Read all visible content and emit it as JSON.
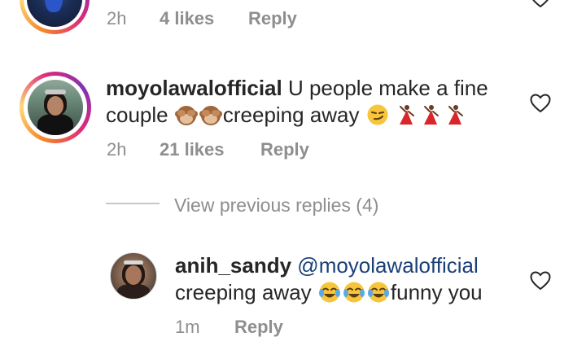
{
  "top_comment": {
    "time": "2h",
    "likes": "4 likes",
    "reply": "Reply"
  },
  "comment": {
    "username": "moyolawalofficial",
    "text_line1": "U people make a fine",
    "text_line2a": "couple",
    "text_line2b": "creeping away",
    "time": "2h",
    "likes": "21 likes",
    "reply": "Reply"
  },
  "view_previous": "View previous replies (4)",
  "reply_comment": {
    "username": "anih_sandy",
    "mention": "@moyolawalofficial",
    "text_a": "creeping away",
    "text_b": "funny you",
    "time": "1m",
    "reply": "Reply"
  },
  "icons": {
    "like": "heart-outline-icon",
    "see_no_evil": "see-no-evil-monkey-icon",
    "smirk": "smirking-face-icon",
    "dancer": "dancer-icon",
    "tears_of_joy": "face-with-tears-of-joy-icon"
  },
  "colors": {
    "meta_gray": "#8e8e8e",
    "mention_blue": "#1a3f77",
    "text": "#262626"
  }
}
